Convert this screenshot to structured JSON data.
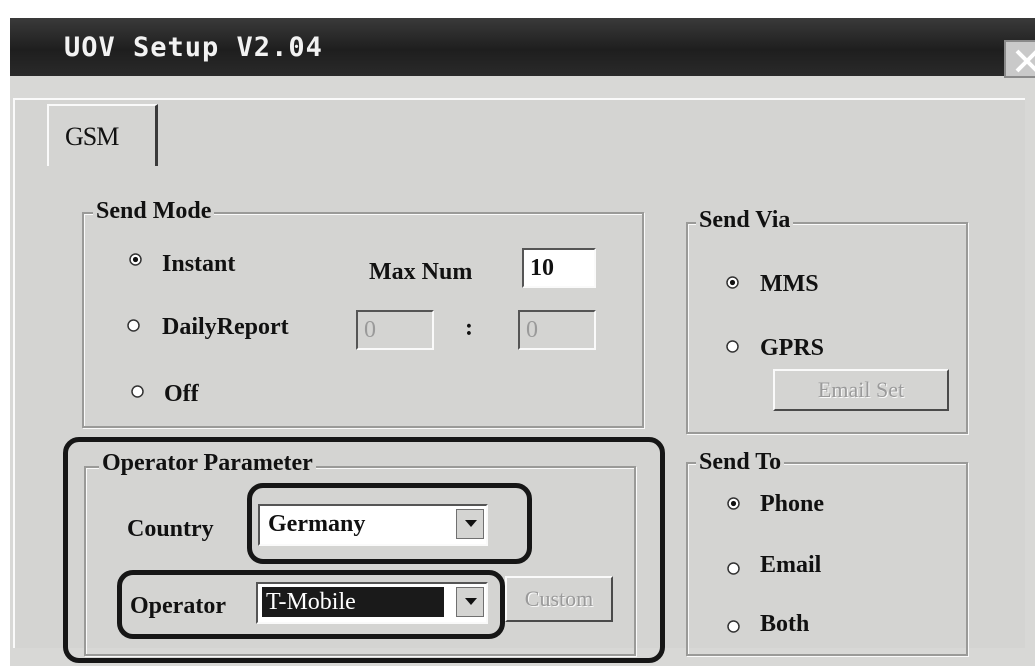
{
  "window": {
    "title": "UOV Setup V2.04"
  },
  "tabs": [
    {
      "label": "GSM"
    }
  ],
  "send_mode": {
    "legend": "Send Mode",
    "options": [
      {
        "label": "Instant",
        "selected": true
      },
      {
        "label": "DailyReport",
        "selected": false
      },
      {
        "label": "Off",
        "selected": false
      }
    ],
    "max_num_label": "Max Num",
    "max_num_value": "10",
    "daily_hour": "0",
    "daily_separator": ":",
    "daily_minute": "0"
  },
  "send_via": {
    "legend": "Send Via",
    "options": [
      {
        "label": "MMS",
        "selected": true
      },
      {
        "label": "GPRS",
        "selected": false
      }
    ],
    "email_set_label": "Email Set"
  },
  "operator_parameter": {
    "legend": "Operator Parameter",
    "country_label": "Country",
    "country_value": "Germany",
    "operator_label": "Operator",
    "operator_value": "T-Mobile",
    "custom_label": "Custom"
  },
  "send_to": {
    "legend": "Send To",
    "options": [
      {
        "label": "Phone",
        "selected": true
      },
      {
        "label": "Email",
        "selected": false
      },
      {
        "label": "Both",
        "selected": false
      }
    ]
  },
  "colors": {
    "title_bar": "#262626",
    "dialog_face": "#d4d4d2",
    "selection": "#1a1a1a",
    "annotation": "#161616"
  }
}
